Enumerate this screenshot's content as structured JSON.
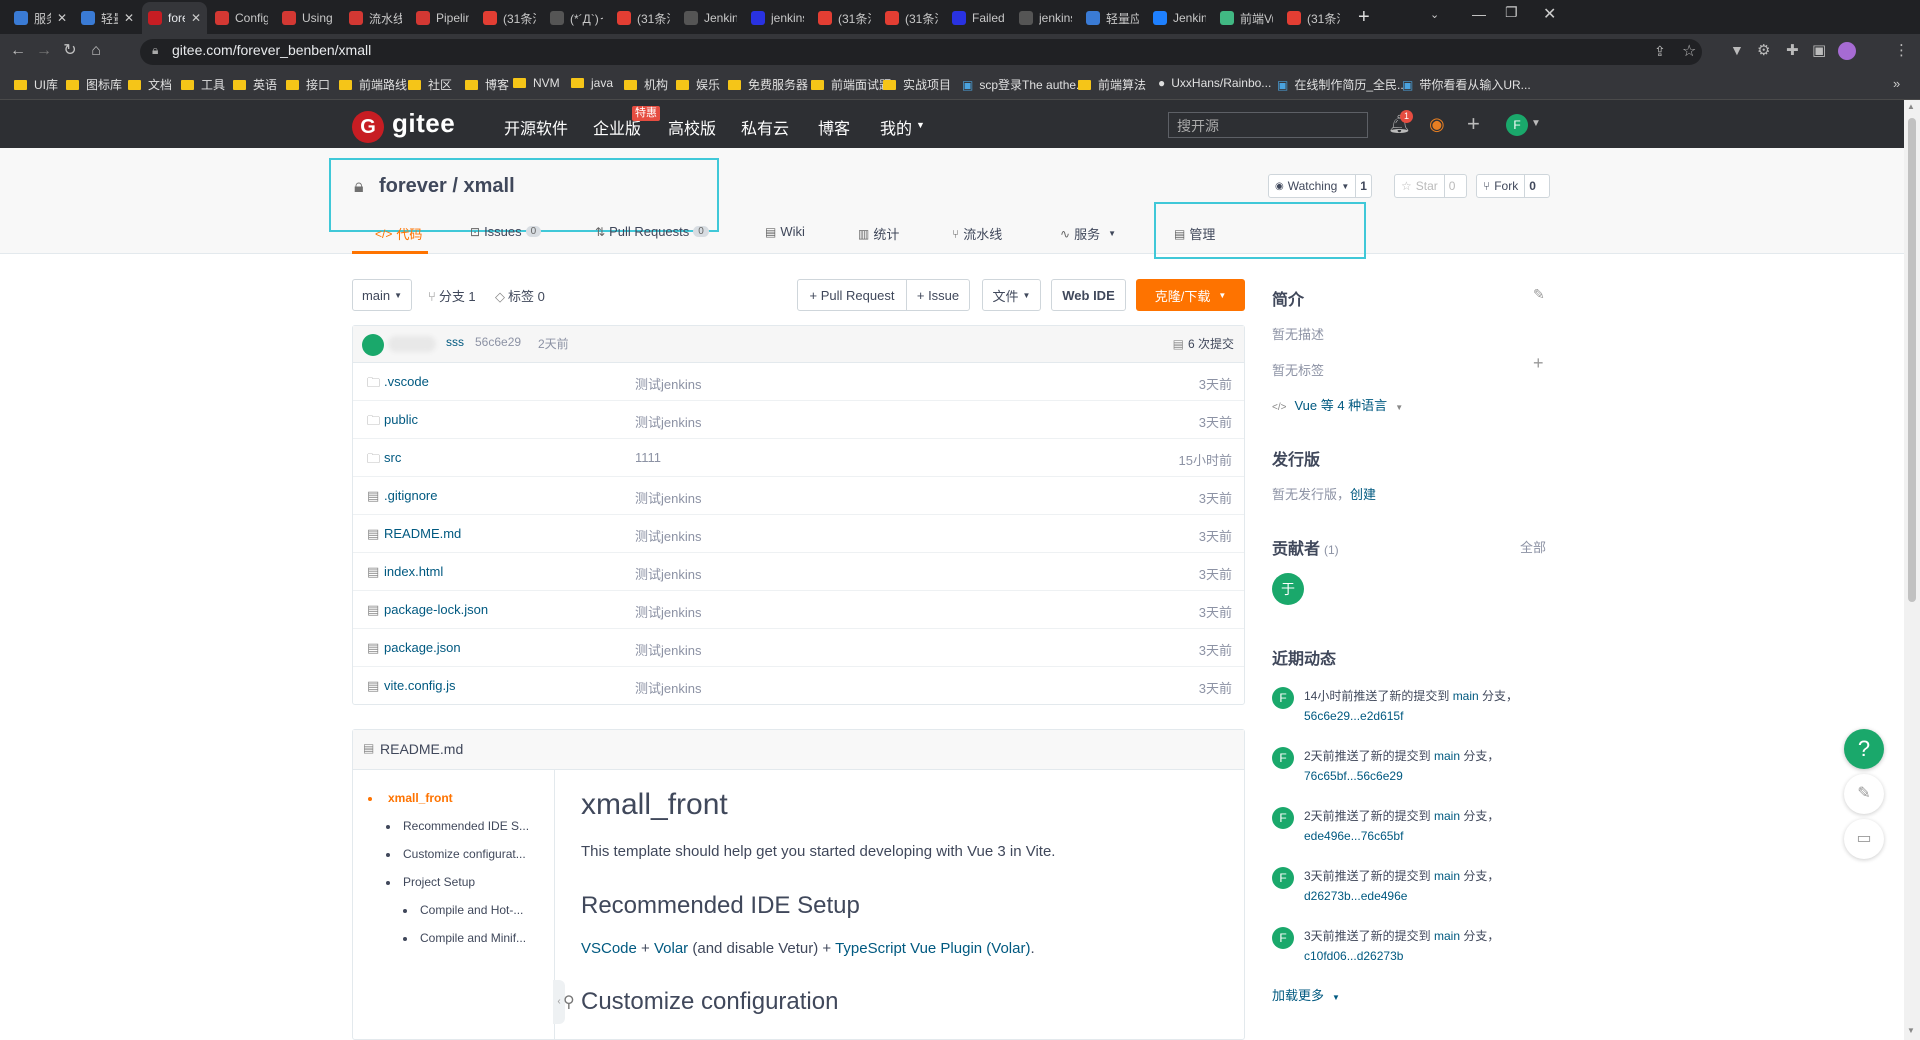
{
  "browser": {
    "tabs": [
      {
        "label": "服务",
        "fav": "cloud-icon",
        "fav_color": "#3a7bd5"
      },
      {
        "label": "轻量",
        "fav": "cloud-icon",
        "fav_color": "#3a7bd5"
      },
      {
        "label": "fore",
        "fav": "gitee-icon",
        "fav_color": "#c71d23",
        "active": true
      },
      {
        "label": "Config",
        "fav": "jenkins-icon",
        "fav_color": "#d33833"
      },
      {
        "label": "Using",
        "fav": "jenkins-icon",
        "fav_color": "#d33833"
      },
      {
        "label": "流水线",
        "fav": "jenkins-icon",
        "fav_color": "#d33833"
      },
      {
        "label": "Pipelin",
        "fav": "jenkins-icon",
        "fav_color": "#d33833"
      },
      {
        "label": "(31条消",
        "fav": "csdn-icon",
        "fav_color": "#e33e33"
      },
      {
        "label": "(*´Д`)っ",
        "fav": "globe-icon",
        "fav_color": "#555"
      },
      {
        "label": "(31条消",
        "fav": "csdn-icon",
        "fav_color": "#e33e33"
      },
      {
        "label": "Jenkins",
        "fav": "globe-icon",
        "fav_color": "#555"
      },
      {
        "label": "jenkins",
        "fav": "baidu-icon",
        "fav_color": "#2932e1"
      },
      {
        "label": "(31条消",
        "fav": "csdn-icon",
        "fav_color": "#e33e33"
      },
      {
        "label": "(31条消",
        "fav": "csdn-icon",
        "fav_color": "#e33e33"
      },
      {
        "label": "Failed t",
        "fav": "baidu-icon",
        "fav_color": "#2932e1"
      },
      {
        "label": "jenkins",
        "fav": "globe-icon",
        "fav_color": "#555"
      },
      {
        "label": "轻量应用",
        "fav": "cloud-icon",
        "fav_color": "#3a7bd5"
      },
      {
        "label": "Jenkins",
        "fav": "juejin-icon",
        "fav_color": "#1e80ff"
      },
      {
        "label": "前端Vu",
        "fav": "vue-icon",
        "fav_color": "#41b883"
      },
      {
        "label": "(31条消",
        "fav": "csdn-icon",
        "fav_color": "#e33e33"
      }
    ],
    "url": "gitee.com/forever_benben/xmall",
    "bookmarks": [
      {
        "label": "UI库",
        "type": "folder"
      },
      {
        "label": "图标库",
        "type": "folder"
      },
      {
        "label": "文档",
        "type": "folder"
      },
      {
        "label": "工具",
        "type": "folder"
      },
      {
        "label": "英语",
        "type": "folder"
      },
      {
        "label": "接口",
        "type": "folder"
      },
      {
        "label": "前端路线",
        "type": "folder"
      },
      {
        "label": "社区",
        "type": "folder"
      },
      {
        "label": "博客",
        "type": "folder"
      },
      {
        "label": "NVM",
        "type": "folder"
      },
      {
        "label": "java",
        "type": "folder"
      },
      {
        "label": "机构",
        "type": "folder"
      },
      {
        "label": "娱乐",
        "type": "folder"
      },
      {
        "label": "免费服务器",
        "type": "folder"
      },
      {
        "label": "前端面试题",
        "type": "folder"
      },
      {
        "label": "实战项目",
        "type": "folder"
      },
      {
        "label": "scp登录The authe...",
        "type": "page"
      },
      {
        "label": "前端算法",
        "type": "folder"
      },
      {
        "label": "UxxHans/Rainbo...",
        "type": "github"
      },
      {
        "label": "在线制作简历_全民...",
        "type": "page"
      },
      {
        "label": "带你看看从输入UR...",
        "type": "page"
      }
    ]
  },
  "header": {
    "logo_letter": "G",
    "logo_text": "gitee",
    "nav": [
      "开源软件",
      "企业版",
      "高校版",
      "私有云",
      "博客",
      "我的"
    ],
    "badge": "特惠",
    "search_placeholder": "搜开源",
    "notif_count": "1",
    "avatar_letter": "F"
  },
  "repo": {
    "title": "forever / xmall",
    "watch_label": "Watching",
    "watch_count": "1",
    "star_label": "Star",
    "star_count": "0",
    "fork_label": "Fork",
    "fork_count": "0",
    "tabs": {
      "code": "代码",
      "issues": "Issues",
      "issues_count": "0",
      "pr": "Pull Requests",
      "pr_count": "0",
      "wiki": "Wiki",
      "stats": "统计",
      "pipeline": "流水线",
      "service": "服务",
      "manage": "管理"
    }
  },
  "toolbar": {
    "branch": "main",
    "branches": "分支 1",
    "tags": "标签 0",
    "pull_request": "+ Pull Request",
    "issue": "+ Issue",
    "file": "文件",
    "web_ide": "Web IDE",
    "clone": "克隆/下载"
  },
  "commit": {
    "message": "sss",
    "hash": "56c6e29",
    "time": "2天前",
    "commits": "6 次提交"
  },
  "files": [
    {
      "name": ".vscode",
      "type": "folder",
      "message": "测试jenkins",
      "time": "3天前"
    },
    {
      "name": "public",
      "type": "folder",
      "message": "测试jenkins",
      "time": "3天前"
    },
    {
      "name": "src",
      "type": "folder",
      "message": "1111",
      "time": "15小时前"
    },
    {
      "name": ".gitignore",
      "type": "file",
      "message": "测试jenkins",
      "time": "3天前"
    },
    {
      "name": "README.md",
      "type": "file",
      "message": "测试jenkins",
      "time": "3天前"
    },
    {
      "name": "index.html",
      "type": "file",
      "message": "测试jenkins",
      "time": "3天前"
    },
    {
      "name": "package-lock.json",
      "type": "file",
      "message": "测试jenkins",
      "time": "3天前"
    },
    {
      "name": "package.json",
      "type": "file",
      "message": "测试jenkins",
      "time": "3天前"
    },
    {
      "name": "vite.config.js",
      "type": "file",
      "message": "测试jenkins",
      "time": "3天前"
    }
  ],
  "readme": {
    "filename": "README.md",
    "toc": [
      "xmall_front",
      "Recommended IDE S...",
      "Customize configurat...",
      "Project Setup",
      "Compile and Hot-...",
      "Compile and Minif..."
    ],
    "h1": "xmall_front",
    "intro": "This template should help get you started developing with Vue 3 in Vite.",
    "h2_ide": "Recommended IDE Setup",
    "link_vscode": "VSCode",
    "link_volar": "Volar",
    "text_disable": " (and disable Vetur) + ",
    "link_ts": "TypeScript Vue Plugin (Volar)",
    "h2_config": "Customize configuration"
  },
  "sidebar": {
    "intro_title": "简介",
    "no_desc": "暂无描述",
    "no_tags": "暂无标签",
    "lang": "Vue 等 4 种语言",
    "release_title": "发行版",
    "no_release": "暂无发行版，",
    "create": "创建",
    "contrib_title": "贡献者",
    "contrib_count": "(1)",
    "all": "全部",
    "contrib_avatar": "于",
    "activity_title": "近期动态",
    "activities": [
      {
        "pre": "14小时前推送了新的提交到 ",
        "branch": "main",
        "mid": " 分支，",
        "range": "56c6e29...e2d615f"
      },
      {
        "pre": "2天前推送了新的提交到 ",
        "branch": "main",
        "mid": " 分支，",
        "range": "76c65bf...56c6e29"
      },
      {
        "pre": "2天前推送了新的提交到 ",
        "branch": "main",
        "mid": " 分支，",
        "range": "ede496e...76c65bf"
      },
      {
        "pre": "3天前推送了新的提交到 ",
        "branch": "main",
        "mid": " 分支，",
        "range": "d26273b...ede496e"
      },
      {
        "pre": "3天前推送了新的提交到 ",
        "branch": "main",
        "mid": " 分支，",
        "range": "c10fd06...d26273b"
      }
    ],
    "load_more": "加载更多"
  },
  "floating": {
    "help": "?"
  }
}
